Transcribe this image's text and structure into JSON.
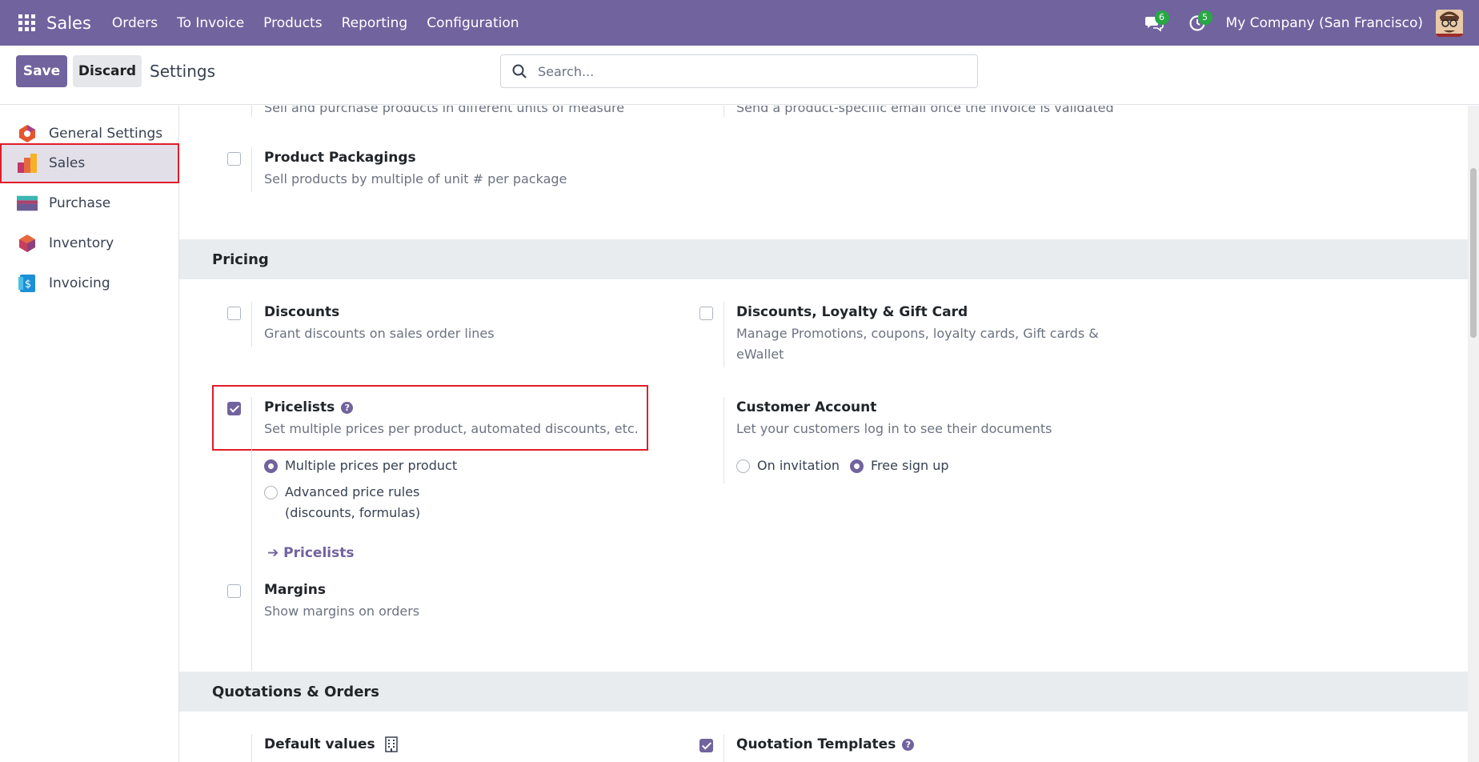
{
  "navbar": {
    "brand": "Sales",
    "menu": [
      "Orders",
      "To Invoice",
      "Products",
      "Reporting",
      "Configuration"
    ],
    "messages_count": "6",
    "activities_count": "5",
    "company": "My Company (San Francisco)"
  },
  "control_panel": {
    "save_label": "Save",
    "discard_label": "Discard",
    "title": "Settings",
    "search_placeholder": "Search..."
  },
  "sidebar": {
    "items": [
      {
        "label": "General Settings"
      },
      {
        "label": "Sales"
      },
      {
        "label": "Purchase"
      },
      {
        "label": "Inventory"
      },
      {
        "label": "Invoicing"
      }
    ],
    "active": "Sales"
  },
  "content": {
    "top_partial": {
      "left_desc": "Sell and purchase products in different units of measure",
      "right_desc": "Send a product-specific email once the invoice is validated"
    },
    "product_packagings": {
      "title": "Product Packagings",
      "desc": "Sell products by multiple of unit # per package",
      "checked": false
    },
    "pricing_header": "Pricing",
    "discounts": {
      "title": "Discounts",
      "desc": "Grant discounts on sales order lines",
      "checked": false
    },
    "loyalty": {
      "title": "Discounts, Loyalty & Gift Card",
      "desc_line1": "Manage Promotions, coupons, loyalty cards, Gift cards &",
      "desc_line2": "eWallet",
      "checked": false
    },
    "pricelists": {
      "title": "Pricelists",
      "desc": "Set multiple prices per product, automated discounts, etc.",
      "checked": true,
      "options": [
        "Multiple prices per product",
        "Advanced price rules",
        "(discounts, formulas)"
      ],
      "selected": "Multiple prices per product",
      "link": "Pricelists"
    },
    "customer_account": {
      "title": "Customer Account",
      "desc": "Let your customers log in to see their documents",
      "options": [
        "On invitation",
        "Free sign up"
      ],
      "selected": "Free sign up"
    },
    "margins": {
      "title": "Margins",
      "desc": "Show margins on orders",
      "checked": false
    },
    "quotations_header": "Quotations & Orders",
    "default_values": {
      "title": "Default values"
    },
    "quotation_templates": {
      "title": "Quotation Templates",
      "checked": true
    }
  },
  "colors": {
    "brand": "#71639e",
    "highlight": "#e11d29",
    "badge": "#28a745"
  }
}
